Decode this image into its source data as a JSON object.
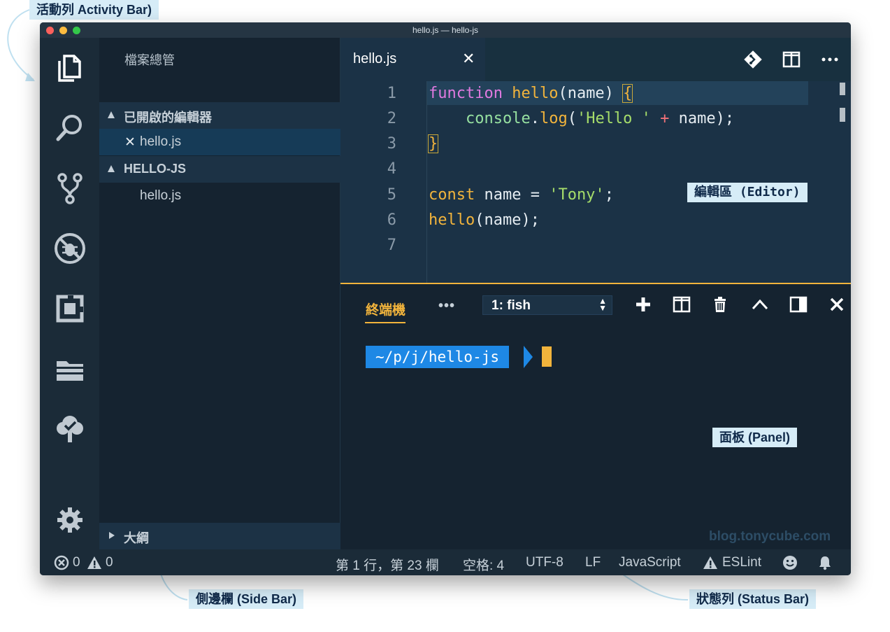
{
  "annotations": {
    "activity_bar": "活動列 Activity Bar)",
    "editor": "編輯區 (Editor)",
    "panel": "面板 (Panel)",
    "side_bar": "側邊欄 (Side Bar)",
    "status_bar": "狀態列 (Status Bar)"
  },
  "window": {
    "title": "hello.js — hello-js"
  },
  "activity_bar": {
    "icons": [
      "explorer-icon",
      "search-icon",
      "source-control-icon",
      "debug-icon",
      "extensions-icon",
      "project-manager-icon",
      "tree-icon",
      "gear-icon"
    ]
  },
  "sidebar": {
    "title": "檔案總管",
    "open_editors": {
      "label": "已開啟的編輯器",
      "items": [
        {
          "label": "hello.js"
        }
      ]
    },
    "folder": {
      "label": "HELLO-JS",
      "items": [
        {
          "label": "hello.js"
        }
      ]
    },
    "outline": {
      "label": "大綱"
    }
  },
  "editor": {
    "tabs": [
      {
        "label": "hello.js",
        "close": "✕"
      }
    ],
    "line_numbers": [
      "1",
      "2",
      "3",
      "4",
      "5",
      "6",
      "7"
    ],
    "code": {
      "l1": {
        "kw": "function",
        "name": "hello",
        "rest": "(name) ",
        "brace": "{"
      },
      "l2": {
        "indent": "    ",
        "obj": "console",
        "dot": ".",
        "method": "log",
        "open": "(",
        "str": "'Hello '",
        "op": "+",
        "rest": " name);"
      },
      "l3": {
        "brace": "}"
      },
      "l5": {
        "kw": "const",
        "rest": " name = ",
        "str": "'Tony'",
        "end": ";"
      },
      "l6": {
        "fn": "hello",
        "rest": "(name);"
      }
    }
  },
  "panel": {
    "tab": "終端機",
    "more": "•••",
    "terminal_select": "1: fish",
    "prompt": "~/p/j/hello-js",
    "watermark": "blog.tonycube.com"
  },
  "statusbar": {
    "errors": "0",
    "warnings": "0",
    "position": "第 1 行，第 23 欄",
    "spaces": "空格: 4",
    "encoding": "UTF-8",
    "eol": "LF",
    "language": "JavaScript",
    "eslint": "ESLint"
  },
  "colors": {
    "accent": "#f2b43c",
    "prompt_blue": "#1e88e5",
    "callout_bg": "#d6ecf7"
  }
}
